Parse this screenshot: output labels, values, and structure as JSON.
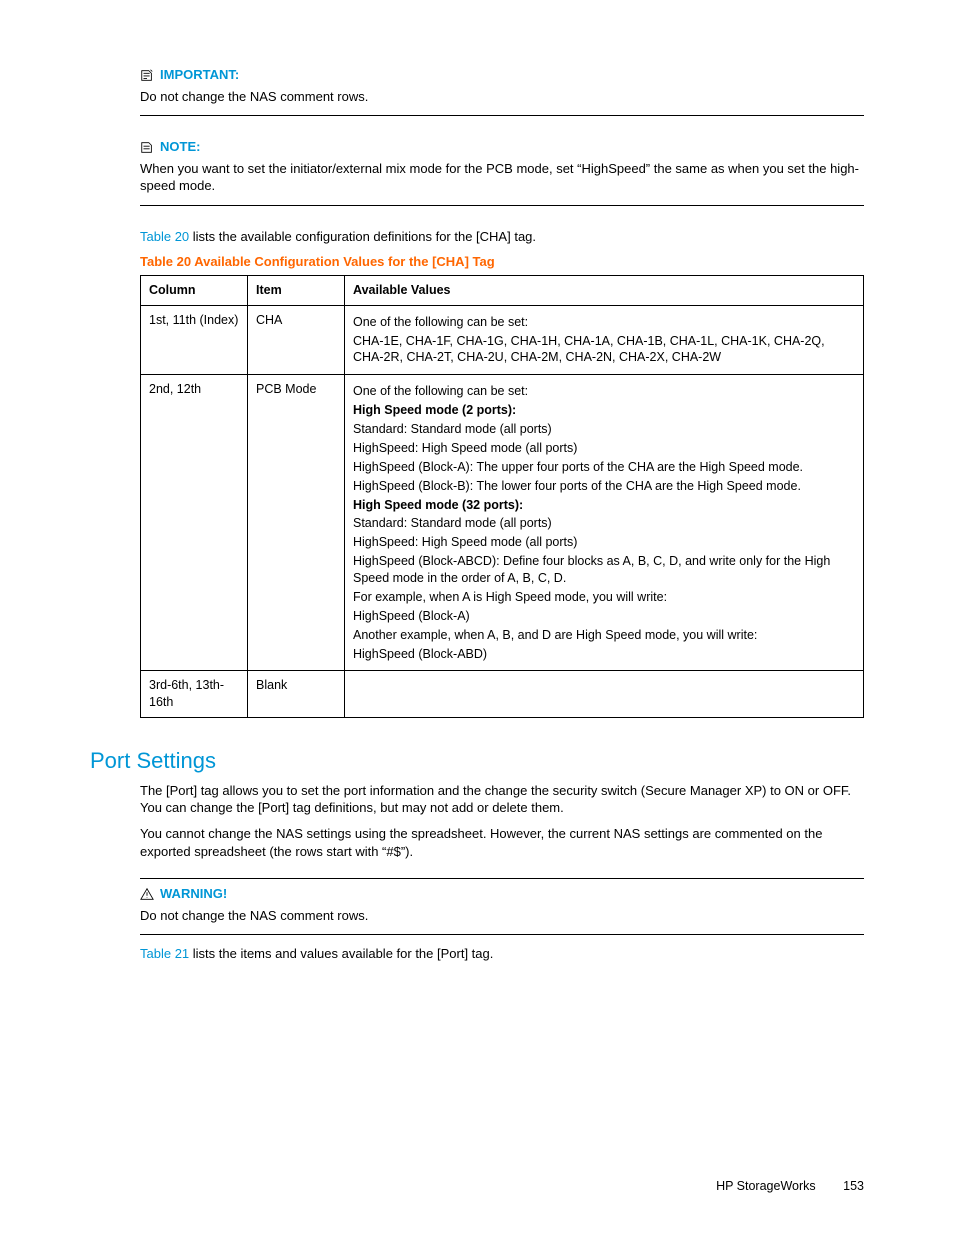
{
  "callouts": {
    "important": {
      "title": "IMPORTANT:",
      "body": "Do not change the NAS comment rows."
    },
    "note": {
      "title": "NOTE:",
      "body": "When you want to set the initiator/external mix mode for the PCB mode, set “HighSpeed” the same as when you set the high-speed mode."
    },
    "warning": {
      "title": "WARNING!",
      "body": "Do not change the NAS comment rows."
    }
  },
  "intro1": {
    "link": "Table 20",
    "rest": " lists the available configuration definitions for the [CHA] tag."
  },
  "table20": {
    "caption": "Table 20 Available Configuration Values for the [CHA] Tag",
    "headers": [
      "Column",
      "Item",
      "Available Values"
    ],
    "rows": [
      {
        "col": "1st, 11th (Index)",
        "item": "CHA",
        "lines": [
          {
            "t": "One of the following can be set:"
          },
          {
            "t": "CHA-1E, CHA-1F, CHA-1G, CHA-1H, CHA-1A, CHA-1B, CHA-1L, CHA-1K, CHA-2Q, CHA-2R, CHA-2T, CHA-2U, CHA-2M, CHA-2N, CHA-2X, CHA-2W"
          }
        ]
      },
      {
        "col": "2nd, 12th",
        "item": "PCB Mode",
        "lines": [
          {
            "t": "One of the following can be set:"
          },
          {
            "t": "High Speed mode (2 ports):",
            "b": true
          },
          {
            "t": "Standard: Standard mode (all ports)"
          },
          {
            "t": "HighSpeed: High Speed mode (all ports)"
          },
          {
            "t": "HighSpeed (Block-A): The upper four ports of the CHA are the High Speed mode."
          },
          {
            "t": "HighSpeed (Block-B): The lower four ports of the CHA are the High Speed mode."
          },
          {
            "t": "High Speed mode (32 ports):",
            "b": true
          },
          {
            "t": "Standard: Standard mode (all ports)"
          },
          {
            "t": "HighSpeed: High Speed mode (all ports)"
          },
          {
            "t": "HighSpeed (Block-ABCD): Define four blocks as A, B, C, D, and write only for the High Speed mode in the order of A, B, C, D."
          },
          {
            "t": "For example, when A is High Speed mode, you will write:"
          },
          {
            "t": "HighSpeed (Block-A)"
          },
          {
            "t": "Another example, when A, B, and D are High Speed mode, you will write:"
          },
          {
            "t": "HighSpeed (Block-ABD)"
          }
        ]
      },
      {
        "col": "3rd-6th, 13th-16th",
        "item": "Blank",
        "lines": []
      }
    ]
  },
  "section": {
    "title": "Port Settings",
    "p1": "The [Port] tag allows you to set the port information and the change the security switch (Secure Manager XP) to ON or OFF. You can change the [Port] tag definitions, but may not add or delete them.",
    "p2": "You cannot change the NAS settings using the spreadsheet. However, the current NAS settings are commented on the exported spreadsheet (the rows start with “#$”)."
  },
  "intro2": {
    "link": "Table 21",
    "rest": " lists the items and values available for the [Port] tag."
  },
  "footer": {
    "text": "HP StorageWorks",
    "page": "153"
  }
}
